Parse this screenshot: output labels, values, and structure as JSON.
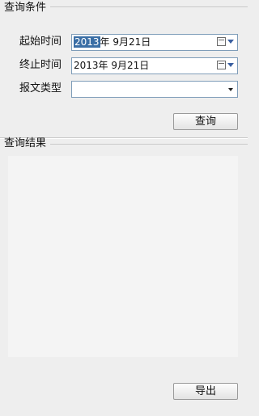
{
  "query_section": {
    "title": "查询条件",
    "start_label": "起始时间",
    "start_year": "2013",
    "start_rest": "年  9月21日",
    "end_label": "终止时间",
    "end_value": "2013年  9月21日",
    "type_label": "报文类型",
    "type_value": "",
    "query_button": "查询"
  },
  "result_section": {
    "title": "查询结果",
    "export_button": "导出"
  }
}
